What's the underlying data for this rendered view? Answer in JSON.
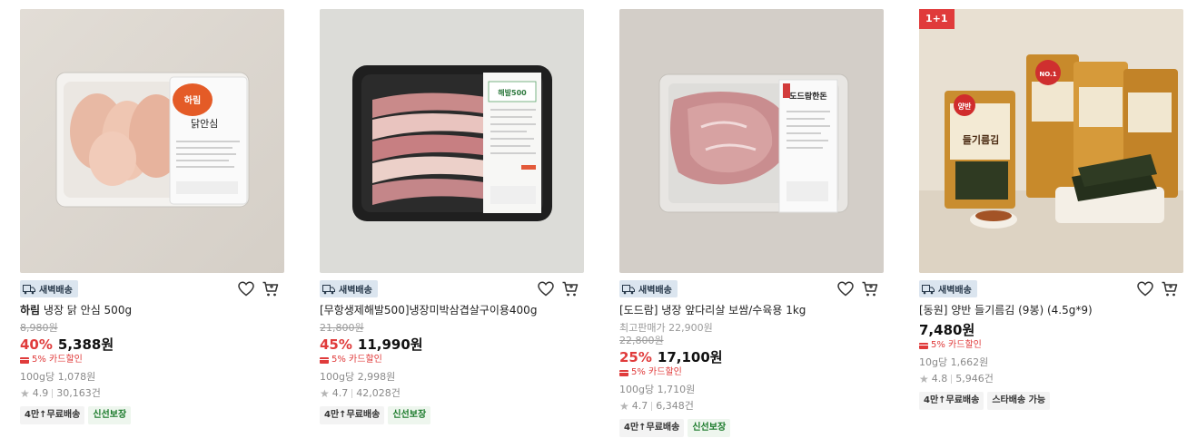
{
  "products": [
    {
      "deal_badge": "",
      "delivery_badge": "새벽배송",
      "title_brand": "하림",
      "title_rest": " 냉장 닭 안심 500g",
      "note": "",
      "original_price": "8,980원",
      "discount": "40%",
      "price": "5,388원",
      "card_sale": "5% 카드할인",
      "unit_price": "100g당 1,078원",
      "rating": "4.9",
      "review_count": "30,163건",
      "tags": [
        "4만↑무료배송",
        "신선보장"
      ],
      "package_label": "하림",
      "package_sub": "닭안심"
    },
    {
      "deal_badge": "",
      "delivery_badge": "새벽배송",
      "title_brand": "",
      "title_rest": "[무항생제해발500]냉장미박삼겹살구이용400g",
      "note": "",
      "original_price": "21,800원",
      "discount": "45%",
      "price": "11,990원",
      "card_sale": "5% 카드할인",
      "unit_price": "100g당 2,998원",
      "rating": "4.7",
      "review_count": "42,028건",
      "tags": [
        "4만↑무료배송",
        "신선보장"
      ],
      "package_label": "해발500",
      "package_sub": ""
    },
    {
      "deal_badge": "",
      "delivery_badge": "새벽배송",
      "title_brand": "",
      "title_rest": "[도드람] 냉장 앞다리살 보쌈/수육용 1kg",
      "note": "최고판매가 22,900원",
      "original_price": "22,800원",
      "discount": "25%",
      "price": "17,100원",
      "card_sale": "5% 카드할인",
      "unit_price": "100g당 1,710원",
      "rating": "4.7",
      "review_count": "6,348건",
      "tags": [
        "4만↑무료배송",
        "신선보장"
      ],
      "package_label": "도드람한돈",
      "package_sub": ""
    },
    {
      "deal_badge": "1+1",
      "delivery_badge": "새벽배송",
      "title_brand": "",
      "title_rest": "[동원] 양반 들기름김 (9봉) (4.5g*9)",
      "note": "",
      "original_price": "",
      "discount": "",
      "price": "7,480원",
      "card_sale": "5% 카드할인",
      "unit_price": "10g당 1,662원",
      "rating": "4.8",
      "review_count": "5,946건",
      "tags": [
        "4만↑무료배송",
        "스타배송 가능"
      ],
      "package_label": "양반",
      "package_sub": "들기름김",
      "package_badge": "NO.1"
    }
  ],
  "colors": {
    "discount": "#e03b3b",
    "dawn_badge_bg": "#dbe5ef",
    "fresh_tag": "#1a7a2a"
  },
  "icons": {
    "delivery": "truck-icon",
    "wishlist": "heart-icon",
    "cart": "cart-icon",
    "rating": "star-icon"
  }
}
